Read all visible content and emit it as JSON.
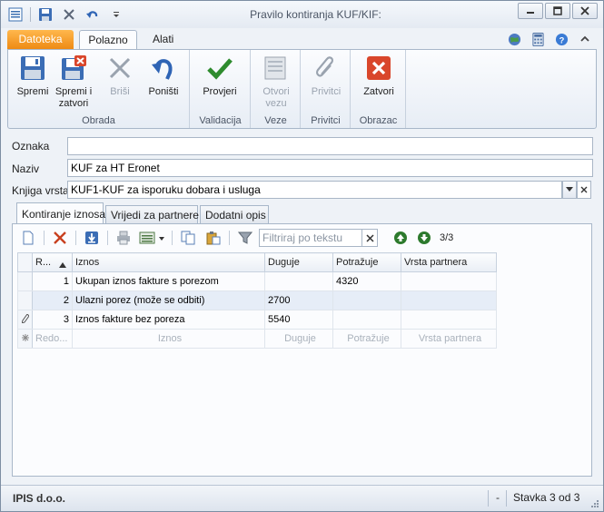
{
  "window": {
    "title": "Pravilo kontiranja KUF/KIF:"
  },
  "ribbon_tabs": {
    "file": "Datoteka",
    "home": "Polazno",
    "tools": "Alati"
  },
  "ribbon": {
    "groups": {
      "obrada": "Obrada",
      "validacija": "Validacija",
      "veze": "Veze",
      "privitci": "Privitci",
      "obrazac": "Obrazac"
    },
    "buttons": {
      "spremi": "Spremi",
      "spremi_i": "Spremi i",
      "zatvori_line": "zatvori",
      "brisi": "Briši",
      "ponisti": "Poništi",
      "provjeri": "Provjeri",
      "otvori": "Otvori",
      "vezu": "vezu",
      "privitci": "Privitci",
      "zatvori": "Zatvori"
    }
  },
  "form": {
    "oznaka_label": "Oznaka",
    "oznaka_value": "",
    "naziv_label": "Naziv",
    "naziv_value": "KUF za HT Eronet",
    "knjiga_label": "Knjiga vrsta",
    "knjiga_value": "KUF1-KUF za isporuku dobara i usluga"
  },
  "inner_tabs": [
    "Kontiranje iznosa",
    "Vrijedi za partnere",
    "Dodatni opis"
  ],
  "grid_toolbar": {
    "filter_placeholder": "Filtriraj po tekstu",
    "counter": "3/3"
  },
  "grid": {
    "columns": [
      "R...",
      "Iznos",
      "Duguje",
      "Potražuje",
      "Vrsta partnera"
    ],
    "rows": [
      {
        "r": "1",
        "iznos": "Ukupan iznos fakture s porezom",
        "duguje": "",
        "potrazuje": "4320",
        "vrsta": ""
      },
      {
        "r": "2",
        "iznos": "Ulazni porez (može se odbiti)",
        "duguje": "2700",
        "potrazuje": "",
        "vrsta": ""
      },
      {
        "r": "3",
        "iznos": "Iznos fakture bez poreza",
        "duguje": "5540",
        "potrazuje": "",
        "vrsta": ""
      }
    ],
    "new_row": [
      "Redo...",
      "Iznos",
      "Duguje",
      "Potražuje",
      "Vrsta partnera"
    ]
  },
  "status": {
    "company": "IPIS d.o.o.",
    "dash": "-",
    "record": "Stavka 3 od 3"
  },
  "colors": {
    "accent_file_tab": "#ee8a14",
    "check_green": "#2e8b2e",
    "close_red": "#d9462b"
  }
}
